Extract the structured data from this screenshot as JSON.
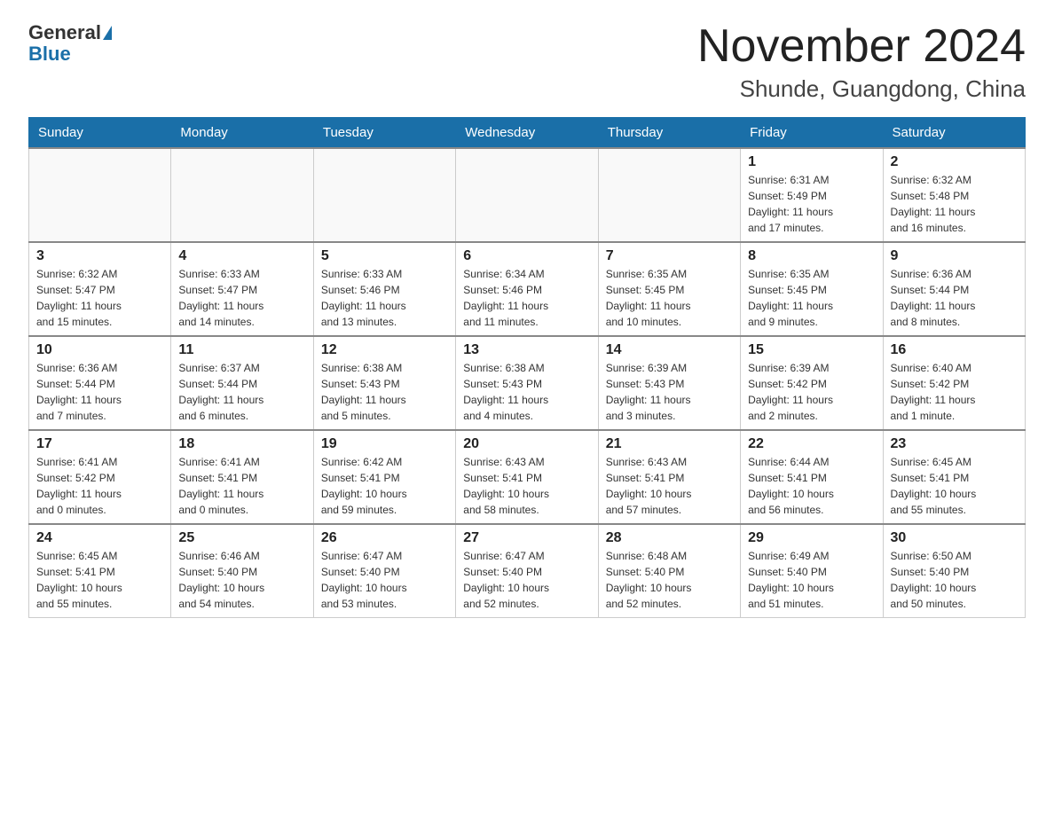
{
  "header": {
    "logo_general": "General",
    "logo_blue": "Blue",
    "month_title": "November 2024",
    "location": "Shunde, Guangdong, China"
  },
  "days_of_week": [
    "Sunday",
    "Monday",
    "Tuesday",
    "Wednesday",
    "Thursday",
    "Friday",
    "Saturday"
  ],
  "weeks": [
    [
      {
        "day": "",
        "info": ""
      },
      {
        "day": "",
        "info": ""
      },
      {
        "day": "",
        "info": ""
      },
      {
        "day": "",
        "info": ""
      },
      {
        "day": "",
        "info": ""
      },
      {
        "day": "1",
        "info": "Sunrise: 6:31 AM\nSunset: 5:49 PM\nDaylight: 11 hours\nand 17 minutes."
      },
      {
        "day": "2",
        "info": "Sunrise: 6:32 AM\nSunset: 5:48 PM\nDaylight: 11 hours\nand 16 minutes."
      }
    ],
    [
      {
        "day": "3",
        "info": "Sunrise: 6:32 AM\nSunset: 5:47 PM\nDaylight: 11 hours\nand 15 minutes."
      },
      {
        "day": "4",
        "info": "Sunrise: 6:33 AM\nSunset: 5:47 PM\nDaylight: 11 hours\nand 14 minutes."
      },
      {
        "day": "5",
        "info": "Sunrise: 6:33 AM\nSunset: 5:46 PM\nDaylight: 11 hours\nand 13 minutes."
      },
      {
        "day": "6",
        "info": "Sunrise: 6:34 AM\nSunset: 5:46 PM\nDaylight: 11 hours\nand 11 minutes."
      },
      {
        "day": "7",
        "info": "Sunrise: 6:35 AM\nSunset: 5:45 PM\nDaylight: 11 hours\nand 10 minutes."
      },
      {
        "day": "8",
        "info": "Sunrise: 6:35 AM\nSunset: 5:45 PM\nDaylight: 11 hours\nand 9 minutes."
      },
      {
        "day": "9",
        "info": "Sunrise: 6:36 AM\nSunset: 5:44 PM\nDaylight: 11 hours\nand 8 minutes."
      }
    ],
    [
      {
        "day": "10",
        "info": "Sunrise: 6:36 AM\nSunset: 5:44 PM\nDaylight: 11 hours\nand 7 minutes."
      },
      {
        "day": "11",
        "info": "Sunrise: 6:37 AM\nSunset: 5:44 PM\nDaylight: 11 hours\nand 6 minutes."
      },
      {
        "day": "12",
        "info": "Sunrise: 6:38 AM\nSunset: 5:43 PM\nDaylight: 11 hours\nand 5 minutes."
      },
      {
        "day": "13",
        "info": "Sunrise: 6:38 AM\nSunset: 5:43 PM\nDaylight: 11 hours\nand 4 minutes."
      },
      {
        "day": "14",
        "info": "Sunrise: 6:39 AM\nSunset: 5:43 PM\nDaylight: 11 hours\nand 3 minutes."
      },
      {
        "day": "15",
        "info": "Sunrise: 6:39 AM\nSunset: 5:42 PM\nDaylight: 11 hours\nand 2 minutes."
      },
      {
        "day": "16",
        "info": "Sunrise: 6:40 AM\nSunset: 5:42 PM\nDaylight: 11 hours\nand 1 minute."
      }
    ],
    [
      {
        "day": "17",
        "info": "Sunrise: 6:41 AM\nSunset: 5:42 PM\nDaylight: 11 hours\nand 0 minutes."
      },
      {
        "day": "18",
        "info": "Sunrise: 6:41 AM\nSunset: 5:41 PM\nDaylight: 11 hours\nand 0 minutes."
      },
      {
        "day": "19",
        "info": "Sunrise: 6:42 AM\nSunset: 5:41 PM\nDaylight: 10 hours\nand 59 minutes."
      },
      {
        "day": "20",
        "info": "Sunrise: 6:43 AM\nSunset: 5:41 PM\nDaylight: 10 hours\nand 58 minutes."
      },
      {
        "day": "21",
        "info": "Sunrise: 6:43 AM\nSunset: 5:41 PM\nDaylight: 10 hours\nand 57 minutes."
      },
      {
        "day": "22",
        "info": "Sunrise: 6:44 AM\nSunset: 5:41 PM\nDaylight: 10 hours\nand 56 minutes."
      },
      {
        "day": "23",
        "info": "Sunrise: 6:45 AM\nSunset: 5:41 PM\nDaylight: 10 hours\nand 55 minutes."
      }
    ],
    [
      {
        "day": "24",
        "info": "Sunrise: 6:45 AM\nSunset: 5:41 PM\nDaylight: 10 hours\nand 55 minutes."
      },
      {
        "day": "25",
        "info": "Sunrise: 6:46 AM\nSunset: 5:40 PM\nDaylight: 10 hours\nand 54 minutes."
      },
      {
        "day": "26",
        "info": "Sunrise: 6:47 AM\nSunset: 5:40 PM\nDaylight: 10 hours\nand 53 minutes."
      },
      {
        "day": "27",
        "info": "Sunrise: 6:47 AM\nSunset: 5:40 PM\nDaylight: 10 hours\nand 52 minutes."
      },
      {
        "day": "28",
        "info": "Sunrise: 6:48 AM\nSunset: 5:40 PM\nDaylight: 10 hours\nand 52 minutes."
      },
      {
        "day": "29",
        "info": "Sunrise: 6:49 AM\nSunset: 5:40 PM\nDaylight: 10 hours\nand 51 minutes."
      },
      {
        "day": "30",
        "info": "Sunrise: 6:50 AM\nSunset: 5:40 PM\nDaylight: 10 hours\nand 50 minutes."
      }
    ]
  ]
}
